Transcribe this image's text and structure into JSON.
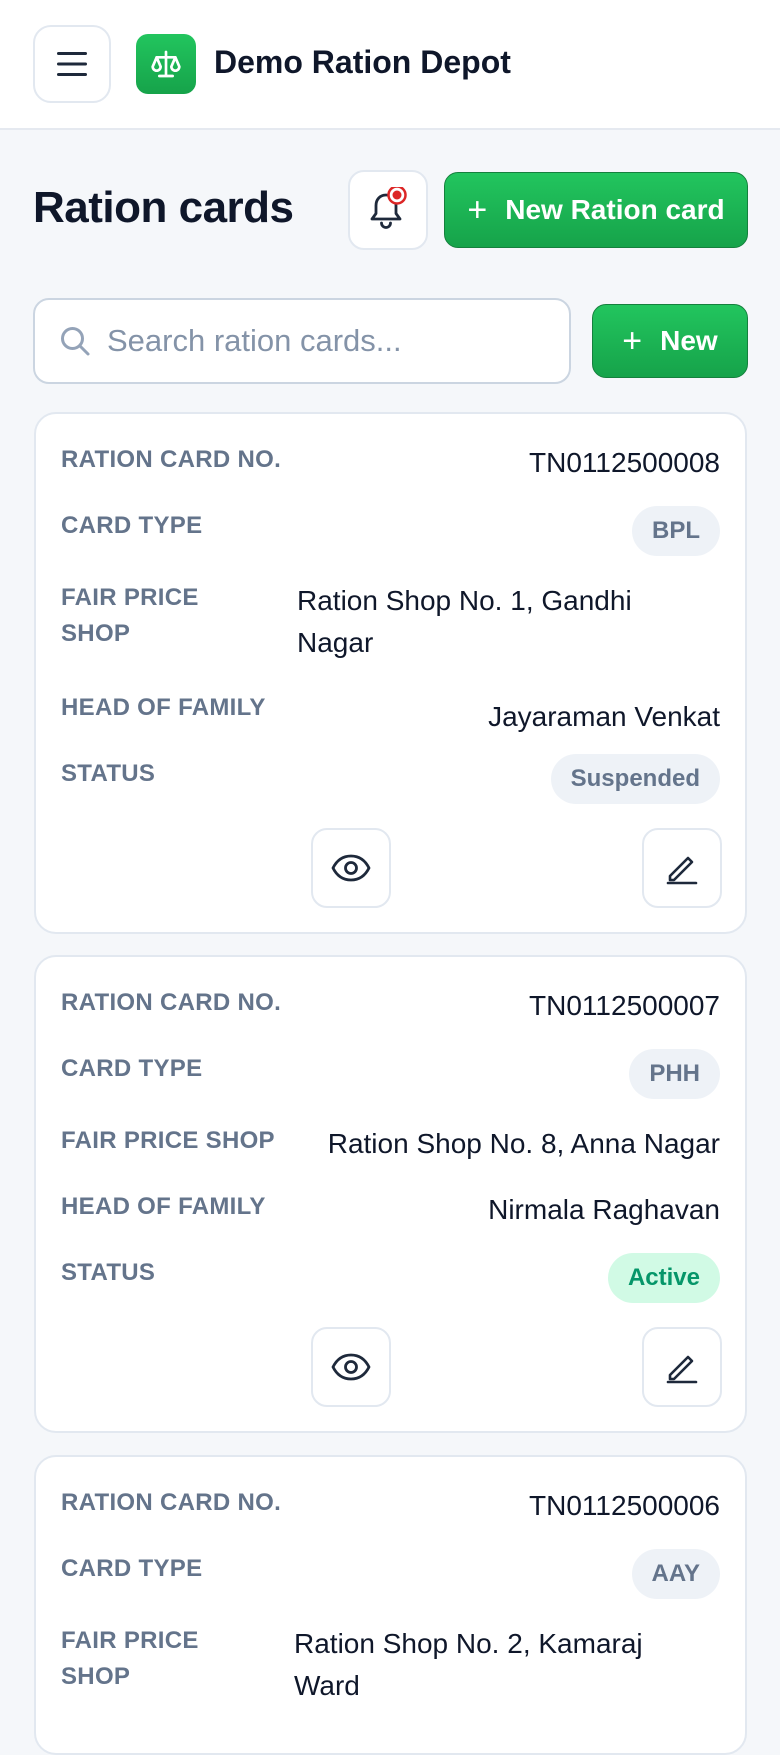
{
  "app": {
    "title": "Demo Ration Depot",
    "logo_icon": "scales-icon"
  },
  "page": {
    "title": "Ration cards",
    "new_card_label": "New Ration card",
    "new_label": "New",
    "notification_icon": "bell-icon",
    "notification_dot_color": "#dc2626"
  },
  "search": {
    "placeholder": "Search ration cards...",
    "value": ""
  },
  "labels": {
    "card_no": "RATION CARD NO.",
    "card_type": "CARD TYPE",
    "shop": "FAIR PRICE SHOP",
    "shop_l1": "FAIR PRICE",
    "shop_l2": "SHOP",
    "head": "HEAD OF FAMILY",
    "status": "STATUS"
  },
  "colors": {
    "accent": "#22c55e",
    "active_bg": "#d1fae5",
    "active_text": "#059669",
    "muted_badge_bg": "#eef2f7"
  },
  "cards": [
    {
      "card_no": "TN0112500008",
      "card_type": "BPL",
      "shop_l1": "Ration Shop No. 1, Gandhi",
      "shop_l2": "Nagar",
      "head": "Jayaraman Venkat",
      "status": "Suspended"
    },
    {
      "card_no": "TN0112500007",
      "card_type": "PHH",
      "shop": "Ration Shop No. 8, Anna Nagar",
      "head": "Nirmala Raghavan",
      "status": "Active"
    },
    {
      "card_no": "TN0112500006",
      "card_type": "AAY",
      "shop_l1": "Ration Shop No. 2, Kamaraj",
      "shop_l2": "Ward"
    }
  ]
}
